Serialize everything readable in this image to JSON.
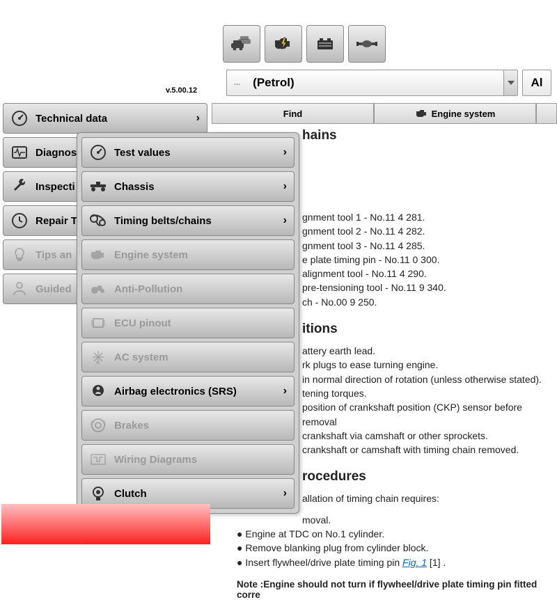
{
  "version": "v.5.00.12",
  "fuel": {
    "dots": "...",
    "label": "(Petrol)",
    "al": "Al"
  },
  "sidebar": [
    {
      "label": "Technical data",
      "chev": true,
      "dim": false
    },
    {
      "label": "Diagnos",
      "chev": false,
      "dim": false
    },
    {
      "label": "Inspecti",
      "chev": false,
      "dim": false
    },
    {
      "label": "Repair T",
      "chev": false,
      "dim": false
    },
    {
      "label": "Tips an",
      "chev": false,
      "dim": true
    },
    {
      "label": "Guided",
      "chev": false,
      "dim": true
    }
  ],
  "submenu": [
    {
      "label": "Test values",
      "chev": true,
      "dim": false
    },
    {
      "label": "Chassis",
      "chev": true,
      "dim": false
    },
    {
      "label": "Timing belts/chains",
      "chev": true,
      "dim": false
    },
    {
      "label": "Engine system",
      "chev": false,
      "dim": true
    },
    {
      "label": "Anti-Pollution",
      "chev": false,
      "dim": true
    },
    {
      "label": "ECU pinout",
      "chev": false,
      "dim": true
    },
    {
      "label": "AC system",
      "chev": false,
      "dim": true
    },
    {
      "label": "Airbag electronics (SRS)",
      "chev": true,
      "dim": false
    },
    {
      "label": "Brakes",
      "chev": false,
      "dim": true
    },
    {
      "label": "Wiring Diagrams",
      "chev": false,
      "dim": true
    },
    {
      "label": "Clutch",
      "chev": true,
      "dim": false
    }
  ],
  "tabs": {
    "find": "Find",
    "engine": "Engine system"
  },
  "content": {
    "title": "hains",
    "tools": [
      "gnment tool 1 - No.11 4 281.",
      "gnment tool 2 - No.11 4 282.",
      "gnment tool 3 - No.11 4 285.",
      "e plate timing pin - No.11 0 300.",
      "alignment tool - No.11 4 290.",
      "pre-tensioning tool - No.11 9 340.",
      "ch - No.00 9 250."
    ],
    "precautions_h": "itions",
    "precautions": [
      "attery earth lead.",
      "rk plugs to ease turning engine.",
      "in normal direction of rotation (unless otherwise stated).",
      "tening torques.",
      "position of crankshaft position (CKP) sensor before removal",
      "crankshaft via camshaft or other sprockets.",
      "crankshaft or camshaft with timing chain removed."
    ],
    "procedures_h": "rocedures",
    "proc_intro": "allation of timing chain requires:",
    "proc_intro2": "moval.",
    "bullets": [
      "Engine at TDC on No.1 cylinder.",
      "Remove blanking plug from cylinder block."
    ],
    "bullet_fig_pre": "Insert flywheel/drive plate timing pin ",
    "bullet_fig_link": "Fig. 1",
    "bullet_fig_post": " [1] .",
    "note": "Note :Engine should not turn if flywheel/drive plate timing pin fitted corre"
  }
}
